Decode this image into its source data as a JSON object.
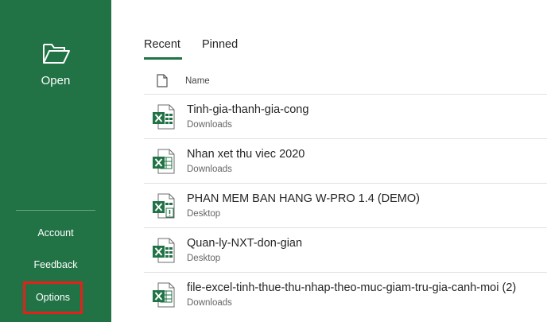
{
  "sidebar": {
    "open_label": "Open",
    "account_label": "Account",
    "feedback_label": "Feedback",
    "options_label": "Options",
    "background_color": "#217346",
    "highlight_color": "#e3211c"
  },
  "tabs": [
    {
      "label": "Recent",
      "selected": true
    },
    {
      "label": "Pinned",
      "selected": false
    }
  ],
  "list_header": {
    "icon": "file-icon",
    "name_label": "Name"
  },
  "files": [
    {
      "name": "Tinh-gia-thanh-gia-cong",
      "location": "Downloads",
      "icon": "excel-file-icon"
    },
    {
      "name": "Nhan xet thu viec 2020",
      "location": "Downloads",
      "icon": "excel-template-icon"
    },
    {
      "name": "PHAN MEM BAN HANG W-PRO 1.4 (DEMO)",
      "location": "Desktop",
      "icon": "excel-macro-file-icon"
    },
    {
      "name": "Quan-ly-NXT-don-gian",
      "location": "Desktop",
      "icon": "excel-file-icon"
    },
    {
      "name": "file-excel-tinh-thue-thu-nhap-theo-muc-giam-tru-gia-canh-moi (2)",
      "location": "Downloads",
      "icon": "excel-template-icon"
    }
  ]
}
